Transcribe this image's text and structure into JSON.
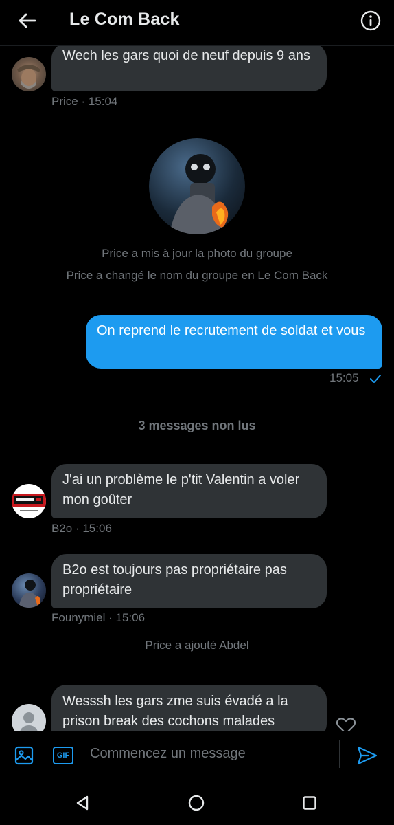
{
  "header": {
    "title": "Le Com Back",
    "back_icon": "arrow-left-icon",
    "info_icon": "info-circle-icon"
  },
  "messages": [
    {
      "text": "Wech les gars quoi de neuf depuis 9 ans",
      "meta": "Price · 15:04"
    },
    {
      "text": "On reprend le recrutement de soldat et vous",
      "meta": "15:05",
      "read_icon": "checkmark-icon"
    },
    {
      "text": "J'ai un problème le p'tit Valentin a voler mon goûter",
      "meta": "B2o · 15:06"
    },
    {
      "text": "B2o est toujours pas propriétaire pas propriétaire",
      "meta": "Founymiel · 15:06"
    },
    {
      "text": "Wesssh les gars zme suis évadé a la prison break des cochons malades"
    }
  ],
  "system": {
    "photo_update": "Price a mis à jour la photo du groupe",
    "name_change": "Price a changé le nom du groupe en Le Com Back",
    "added": "Price a ajouté Abdel"
  },
  "unread_divider": "3 messages non lus",
  "composer": {
    "placeholder": "Commencez un message",
    "gif_label": "GIF"
  },
  "colors": {
    "accent": "#1d9bf0",
    "bubble": "#2f3336",
    "muted": "#71767b",
    "background": "#000000"
  }
}
